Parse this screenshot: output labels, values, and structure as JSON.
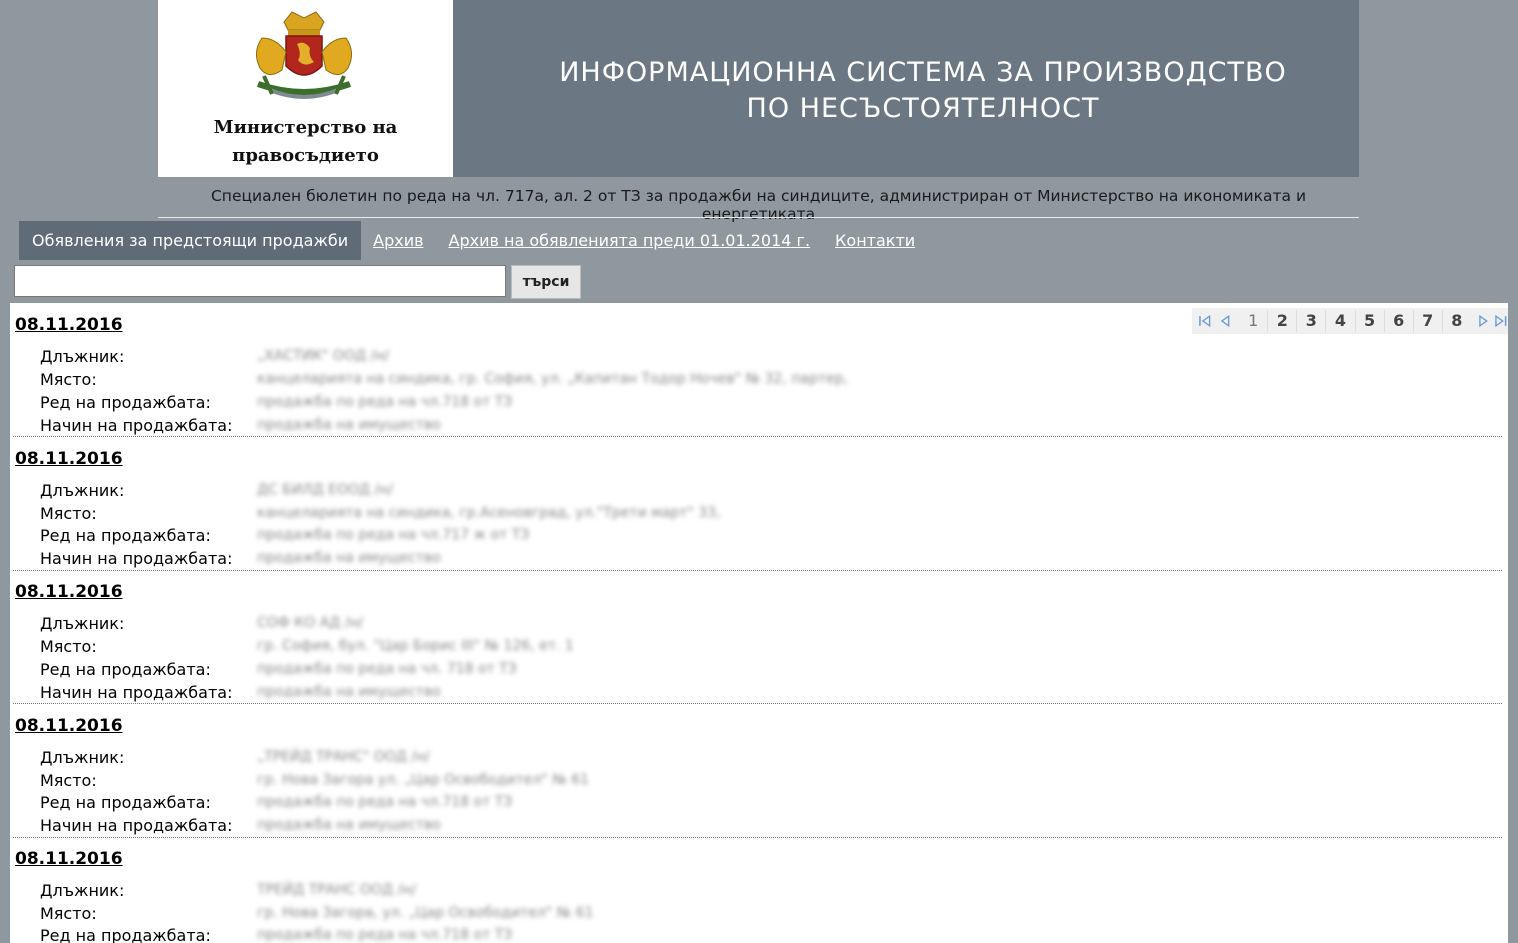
{
  "header": {
    "ministry_name": "Министерство на\nправосъдието",
    "system_title": "ИНФОРМАЦИОННА СИСТЕМА ЗА ПРОИЗВОДСТВО\nПО НЕСЪСТОЯТЕЛНОСТ",
    "subtitle": "Специален бюлетин по реда на чл. 717а, ал. 2 от ТЗ за продажби на синдиците, администриран от Министерство на икономиката и енергетиката"
  },
  "nav": {
    "active": "Обявления за предстоящи продажби",
    "links": [
      "Архив",
      "Архив на обявленията преди 01.01.2014 г.",
      "Контакти"
    ]
  },
  "search": {
    "value": "",
    "button_label": "търси"
  },
  "pager": {
    "pages": [
      "1",
      "2",
      "3",
      "4",
      "5",
      "6",
      "7",
      "8"
    ],
    "current": "1"
  },
  "labels": {
    "debtor": "Длъжник:",
    "place": "Място:",
    "sale_order": "Ред на продажбата:",
    "sale_method": "Начин на продажбата:"
  },
  "entries": [
    {
      "date": "08.11.2016",
      "debtor": "„ХАСТИК\" ООД /н/",
      "place": "канцеларията на синдика, гр. София, ул. „Капитан Тодор Ночев\" № 32, партер,",
      "sale_order": "продажба по реда на чл.718 от ТЗ",
      "sale_method": "продажба на имущество"
    },
    {
      "date": "08.11.2016",
      "debtor": "ДС БИЛД ЕООД /н/",
      "place": "канцеларията на синдика, гр.Асеновград, ул.\"Трети март\" 33,",
      "sale_order": "продажба по реда на чл.717 ж от ТЗ",
      "sale_method": "продажба на имущество"
    },
    {
      "date": "08.11.2016",
      "debtor": "СОФ КО АД /н/",
      "place": "гр. София, бул. \"Цар Борис III\" № 126, ет. 1",
      "sale_order": "продажба по реда на чл. 718 от ТЗ",
      "sale_method": "продажба на имущество"
    },
    {
      "date": "08.11.2016",
      "debtor": "„ТРЕЙД ТРАНС\" ООД /н/",
      "place": "гр. Нова Загора ул. „Цар Освободител\" № 61",
      "sale_order": "продажба по реда на чл.718 от ТЗ",
      "sale_method": "продажба на имущество"
    },
    {
      "date": "08.11.2016",
      "debtor": "ТРЕЙД ТРАНС ООД /н/",
      "place": "гр. Нова Загора, ул. „Цар Освободител\" № 61",
      "sale_order": "продажба по реда на чл.718 от ТЗ",
      "sale_method": ""
    }
  ],
  "colors": {
    "page_background": "#8f989f",
    "banner": "#6b7883",
    "nav_active": "#5f6c77"
  }
}
